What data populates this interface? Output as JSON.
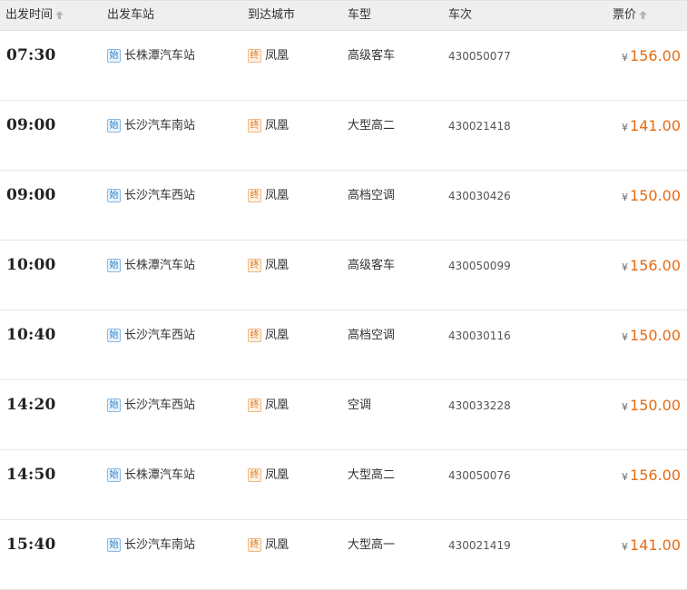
{
  "headers": {
    "depart_time": "出发时间",
    "depart_station": "出发车站",
    "arrive_city": "到达城市",
    "bus_type": "车型",
    "trip_no": "车次",
    "price": "票价"
  },
  "badges": {
    "start": "始",
    "end": "终"
  },
  "currency_symbol": "¥",
  "rows": [
    {
      "time": "07:30",
      "station": "长株潭汽车站",
      "city": "凤凰",
      "type": "高级客车",
      "trip": "430050077",
      "price": "156.00"
    },
    {
      "time": "09:00",
      "station": "长沙汽车南站",
      "city": "凤凰",
      "type": "大型高二",
      "trip": "430021418",
      "price": "141.00"
    },
    {
      "time": "09:00",
      "station": "长沙汽车西站",
      "city": "凤凰",
      "type": "高档空调",
      "trip": "430030426",
      "price": "150.00"
    },
    {
      "time": "10:00",
      "station": "长株潭汽车站",
      "city": "凤凰",
      "type": "高级客车",
      "trip": "430050099",
      "price": "156.00"
    },
    {
      "time": "10:40",
      "station": "长沙汽车西站",
      "city": "凤凰",
      "type": "高档空调",
      "trip": "430030116",
      "price": "150.00"
    },
    {
      "time": "14:20",
      "station": "长沙汽车西站",
      "city": "凤凰",
      "type": "空调",
      "trip": "430033228",
      "price": "150.00"
    },
    {
      "time": "14:50",
      "station": "长株潭汽车站",
      "city": "凤凰",
      "type": "大型高二",
      "trip": "430050076",
      "price": "156.00"
    },
    {
      "time": "15:40",
      "station": "长沙汽车南站",
      "city": "凤凰",
      "type": "大型高一",
      "trip": "430021419",
      "price": "141.00"
    }
  ]
}
